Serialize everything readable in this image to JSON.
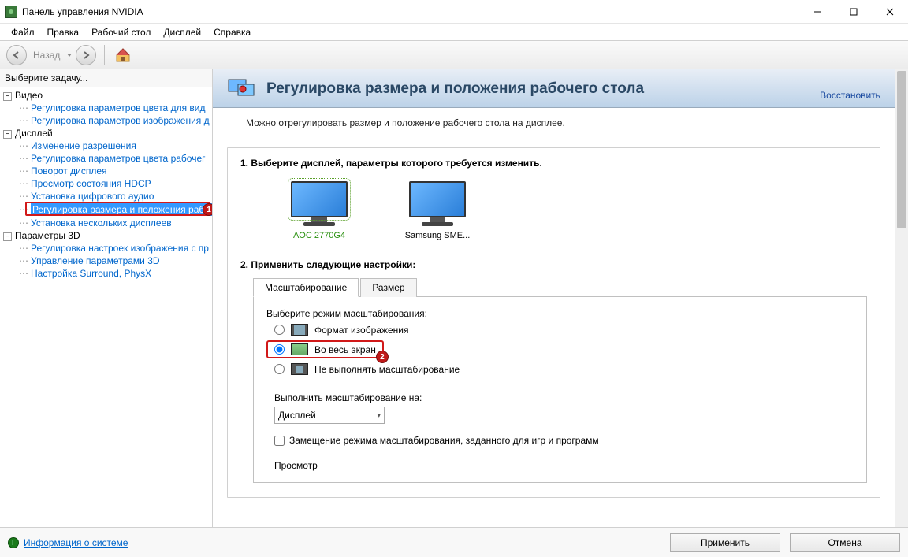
{
  "window": {
    "title": "Панель управления NVIDIA"
  },
  "menu": {
    "items": [
      "Файл",
      "Правка",
      "Рабочий стол",
      "Дисплей",
      "Справка"
    ]
  },
  "toolbar": {
    "back_label": "Назад"
  },
  "sidebar": {
    "header": "Выберите задачу...",
    "video": {
      "title": "Видео",
      "items": [
        "Регулировка параметров цвета для вид",
        "Регулировка параметров изображения д"
      ]
    },
    "display": {
      "title": "Дисплей",
      "items": [
        "Изменение разрешения",
        "Регулировка параметров цвета рабочег",
        "Поворот дисплея",
        "Просмотр состояния HDCP",
        "Установка цифрового аудио",
        "Регулировка размера и положения рабоч",
        "Установка нескольких дисплеев"
      ],
      "selected_index": 5
    },
    "params3d": {
      "title": "Параметры 3D",
      "items": [
        "Регулировка настроек изображения с пр",
        "Управление параметрами 3D",
        "Настройка Surround, PhysX"
      ]
    }
  },
  "page": {
    "title": "Регулировка размера и положения рабочего стола",
    "restore": "Восстановить",
    "description": "Можно отрегулировать размер и положение рабочего стола на дисплее.",
    "step1": {
      "title": "1. Выберите дисплей, параметры которого требуется изменить.",
      "monitors": [
        {
          "label": "AOC 2770G4",
          "primary": true
        },
        {
          "label": "Samsung SME...",
          "primary": false
        }
      ]
    },
    "step2": {
      "title": "2. Применить следующие настройки:",
      "tabs": [
        "Масштабирование",
        "Размер"
      ],
      "scaling_label": "Выберите режим масштабирования:",
      "options": [
        "Формат изображения",
        "Во весь экран",
        "Не выполнять масштабирование"
      ],
      "perform_on_label": "Выполнить масштабирование на:",
      "perform_on_value": "Дисплей",
      "override_label": "Замещение режима масштабирования, заданного для игр и программ",
      "preview_label": "Просмотр"
    }
  },
  "footer": {
    "sysinfo": "Информация о системе",
    "apply": "Применить",
    "cancel": "Отмена"
  },
  "annotations": {
    "badge1": "1",
    "badge2": "2"
  }
}
